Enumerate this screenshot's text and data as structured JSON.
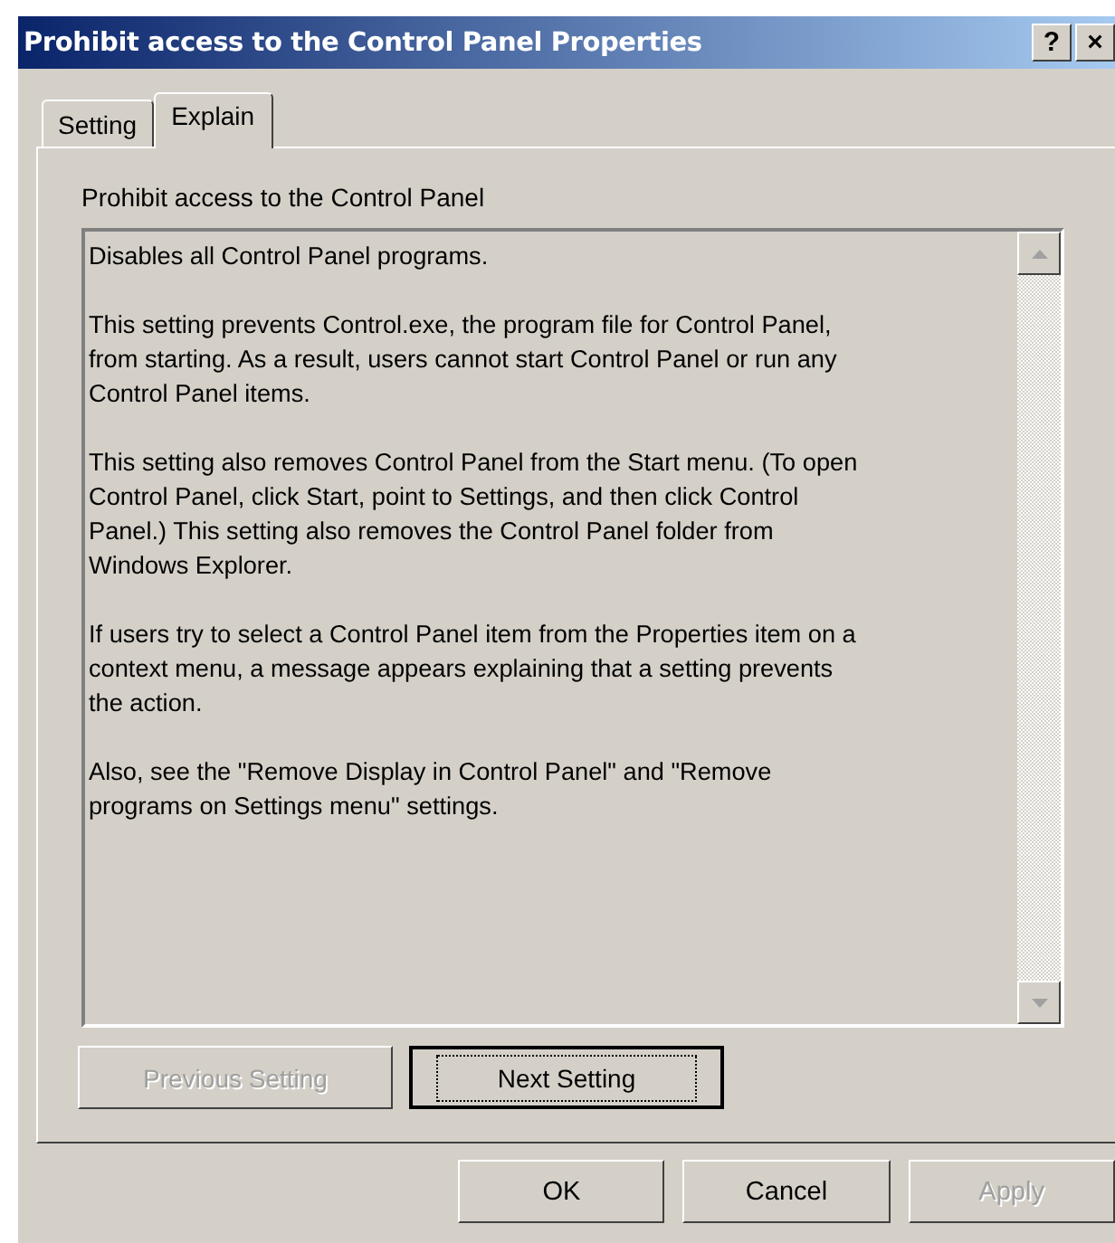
{
  "window": {
    "title": "Prohibit access to the Control Panel Properties",
    "title_buttons": [
      "?",
      "×"
    ]
  },
  "tabs": [
    {
      "label": "Setting",
      "selected": false
    },
    {
      "label": "Explain",
      "selected": true
    }
  ],
  "heading": "Prohibit access to the Control Panel",
  "explain_text": [
    [
      "Disables all Control Panel programs."
    ],
    [
      "This setting prevents Control.exe, the program file for Control Panel,",
      "from starting. As a result, users cannot start Control Panel or run any",
      "Control Panel items."
    ],
    [
      "This setting also removes Control Panel from the Start menu. (To open",
      "Control Panel, click Start, point to Settings, and then click Control",
      "Panel.) This setting also removes the Control Panel folder from",
      "Windows Explorer."
    ],
    [
      "If users try to select a Control Panel item from the Properties item on a",
      "context menu, a message appears explaining that a setting prevents",
      "the action."
    ],
    [
      "Also, see the \"Remove Display in Control Panel\" and \"Remove",
      "programs on Settings menu\" settings."
    ]
  ],
  "nav_buttons": [
    {
      "label": "Previous Setting",
      "disabled": true,
      "focused": false
    },
    {
      "label": "Next Setting",
      "disabled": false,
      "focused": true
    }
  ],
  "dialog_buttons": [
    {
      "label": "OK",
      "disabled": false
    },
    {
      "label": "Cancel",
      "disabled": false
    },
    {
      "label": "Apply",
      "disabled": true
    }
  ]
}
